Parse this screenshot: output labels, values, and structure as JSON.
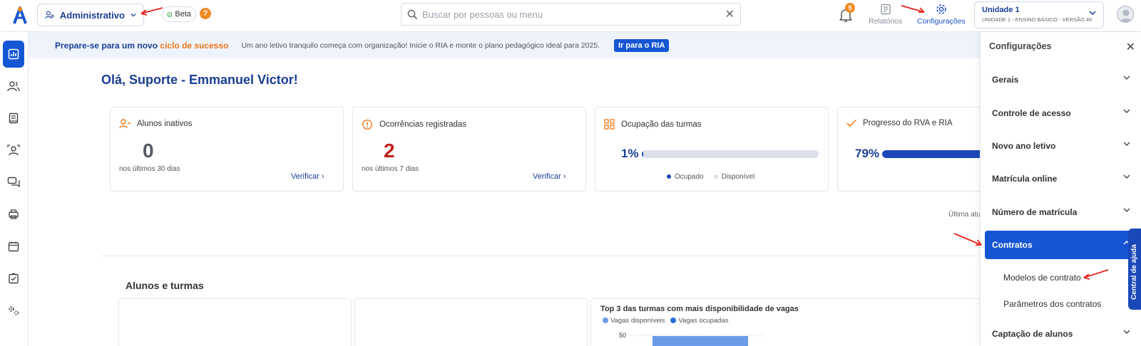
{
  "header": {
    "module_label": "Administrativo",
    "beta_label": "Beta",
    "help_label": "?",
    "search_placeholder": "Buscar por pessoas ou menu",
    "notifications_count": "5",
    "reports_label": "Relatórios",
    "settings_label": "Configurações",
    "unit_name": "Unidade 1",
    "unit_detail": "UNIDADE 1 - ENSINO BÁSICO - VERSÃO 46"
  },
  "sidebar": {
    "items": [
      "dashboard-icon",
      "people-icon",
      "book-icon",
      "student-icon",
      "chat-icon",
      "printer-icon",
      "calendar-icon",
      "task-icon",
      "settings-gears-icon"
    ]
  },
  "banner": {
    "title_prefix": "Prepare-se para um novo ",
    "title_accent": "ciclo de sucesso",
    "text": "Um ano letivo tranquilo começa com organização! Inicie o RIA e monte o plano pedagógico ideal para 2025.",
    "button_label": "Ir para o RIA"
  },
  "greeting": "Olá, Suporte - Emmanuel Victor!",
  "cards": {
    "inactive": {
      "title": "Alunos inativos",
      "value": "0",
      "sub": "nos últimos 30 dias",
      "action": "Verificar"
    },
    "occurrences": {
      "title": "Ocorrências registradas",
      "value": "2",
      "sub": "nos últimos 7 dias",
      "action": "Verificar"
    },
    "occupancy": {
      "title": "Ocupação das turmas",
      "percent_label": "1%",
      "percent": 1,
      "legend_occupied": "Ocupado",
      "legend_available": "Disponível"
    },
    "progress": {
      "title": "Progresso do RVA e RIA",
      "percent_label": "79%",
      "percent": 79
    }
  },
  "last_update_label": "Última atu",
  "students_section": {
    "title": "Alunos e turmas",
    "chart_title": "Top 3 das turmas com mais disponibilidade de vagas",
    "legend_available": "Vagas disponíveis",
    "legend_occupied": "Vagas ocupadas",
    "y_tick": "50"
  },
  "chart_data": {
    "type": "bar",
    "title": "Top 3 das turmas com mais disponibilidade de vagas",
    "series": [
      {
        "name": "Vagas disponíveis"
      },
      {
        "name": "Vagas ocupadas"
      }
    ],
    "y_ticks": [
      50
    ]
  },
  "settings_panel": {
    "title": "Configurações",
    "items": [
      "Gerais",
      "Controle de acesso",
      "Novo ano letivo",
      "Matrícula online",
      "Número de matrícula",
      "Contratos",
      "Captação de alunos"
    ],
    "active_item": "Contratos",
    "sub_items": [
      "Modelos de contrato",
      "Parâmetros dos contratos"
    ]
  },
  "help_tab_label": "Central de ajuda",
  "colors": {
    "primary": "#1556d4",
    "brand_dark": "#1a3e96",
    "accent_orange": "#f08b24",
    "danger": "#c0201a",
    "annotation_red": "#e8231f"
  }
}
